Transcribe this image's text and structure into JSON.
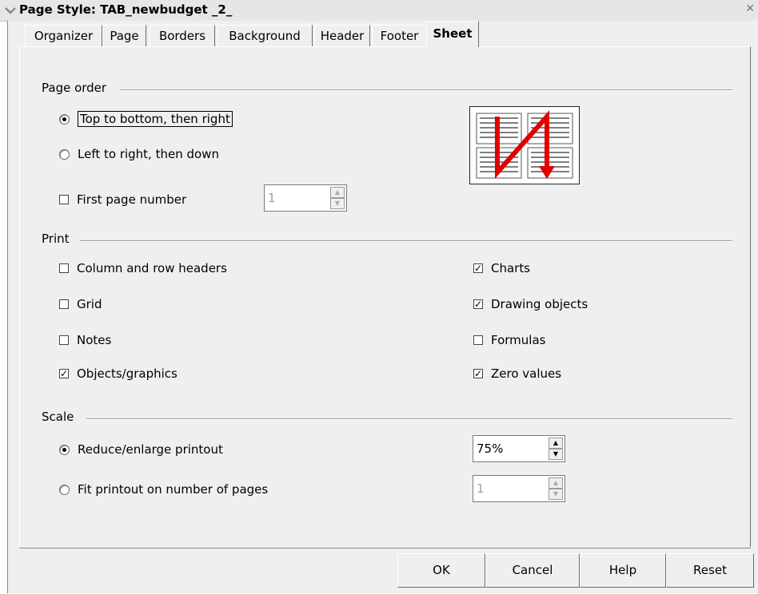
{
  "window": {
    "title": "Page Style: TAB_newbudget _2_"
  },
  "tabs": [
    "Organizer",
    "Page",
    "Borders",
    "Background",
    "Header",
    "Footer",
    "Sheet"
  ],
  "active_tab": "Sheet",
  "page_order": {
    "label": "Page order",
    "top_to_bottom": "Top to bottom, then right",
    "left_to_right": "Left to right, then down",
    "first_page_number_label": "First page number",
    "first_page_number_value": "1"
  },
  "print": {
    "label": "Print",
    "column_row_headers": "Column and row headers",
    "grid": "Grid",
    "notes": "Notes",
    "objects_graphics": "Objects/graphics",
    "charts": "Charts",
    "drawing_objects": "Drawing objects",
    "formulas": "Formulas",
    "zero_values": "Zero values"
  },
  "scale": {
    "label": "Scale",
    "reduce_enlarge": "Reduce/enlarge printout",
    "reduce_enlarge_value": "75%",
    "fit_pages": "Fit printout on number of pages",
    "fit_pages_value": "1"
  },
  "buttons": {
    "ok": "OK",
    "cancel": "Cancel",
    "help": "Help",
    "reset": "Reset"
  }
}
